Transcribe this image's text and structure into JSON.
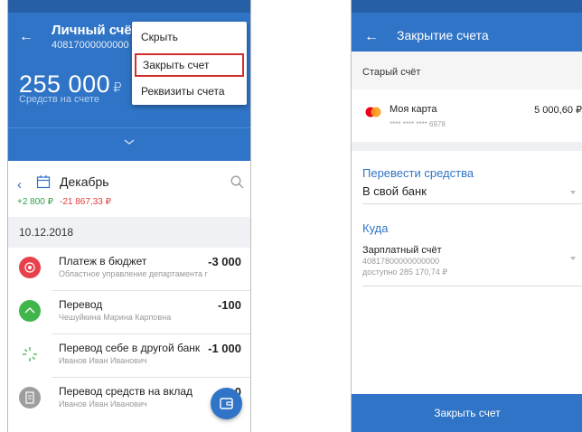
{
  "left_screen": {
    "header": {
      "title": "Личный счёт",
      "account_number": "40817000000000",
      "balance": "255 000",
      "currency": "₽",
      "balance_label": "Средств на счете"
    },
    "menu": {
      "items": [
        "Скрыть",
        "Закрыть счет",
        "Реквизиты счета"
      ]
    },
    "month": {
      "name": "Декабрь",
      "income": "+2 800 ₽",
      "expense": "-21 867,33 ₽"
    },
    "date": "10.12.2018",
    "transactions": [
      {
        "title": "Платеж в бюджет",
        "subtitle": "Областное управление департамента г",
        "amount": "-3 000",
        "color": "#e8414c"
      },
      {
        "title": "Перевод",
        "subtitle": "Чешуйкина Марина Карповна",
        "amount": "-100",
        "color": "#3fb54a"
      },
      {
        "title": "Перевод себе в другой банк",
        "subtitle": "Иванов Иван Иванович",
        "amount": "-1 000",
        "color": "#ffffff"
      },
      {
        "title": "Перевод средств на вклад",
        "subtitle": "Иванов Иван Иванович",
        "amount": "-0",
        "color": "#9e9e9e"
      }
    ]
  },
  "right_screen": {
    "header": {
      "title": "Закрытие счета"
    },
    "old_account_label": "Старый счёт",
    "card": {
      "name": "Моя карта",
      "mask": "**** **** **** 6978",
      "balance": "5 000,60 ₽"
    },
    "transfer": {
      "label": "Перевести средства",
      "value": "В свой банк"
    },
    "destination": {
      "label": "Куда",
      "title": "Зарплатный счёт",
      "number": "40817800000000000",
      "available": "доступно 285 170,74 ₽"
    },
    "submit_label": "Закрыть счет"
  },
  "colors": {
    "primary": "#2f74c6",
    "income": "#2e9e45",
    "expense": "#e23a3a",
    "highlight": "#d32f2f"
  }
}
